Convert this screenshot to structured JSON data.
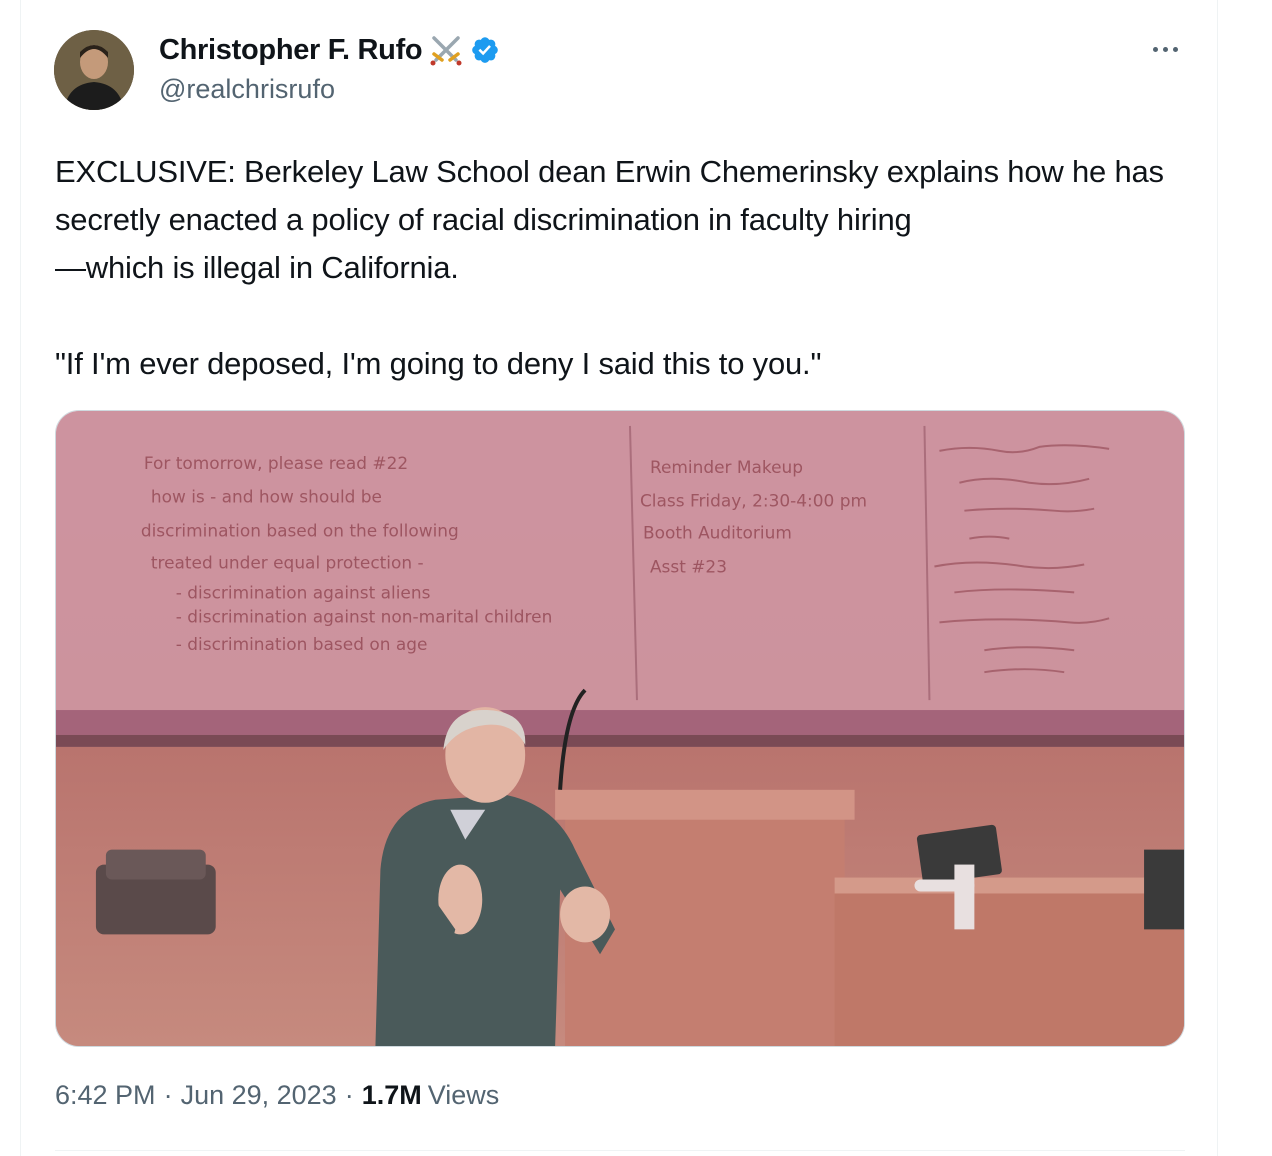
{
  "author": {
    "display_name": "Christopher F. Rufo",
    "handle": "@realchrisrufo",
    "name_emoji": "crossed-swords-icon",
    "verified": true
  },
  "tweet": {
    "paragraph1": "EXCLUSIVE: Berkeley Law School dean Erwin Chemerinsky explains how he has secretly enacted a policy of racial discrimination in faculty hiring\n—which is illegal in California.",
    "paragraph2": "\"If I'm ever deposed, I'm going to deny I said this to you.\""
  },
  "media": {
    "type": "video",
    "board_left": [
      "For tomorrow, please read #22",
      "how is - and how should be",
      "discrimination based on the following",
      "treated under equal protection -",
      "- discrimination against aliens",
      "- discrimination against non-marital children",
      "- discrimination based on age"
    ],
    "board_middle": [
      "Reminder Makeup",
      "Class Friday, 2:30-4:00 pm",
      "Booth Auditorium",
      "Asst #23"
    ]
  },
  "meta": {
    "time": "6:42 PM",
    "date": "Jun 29, 2023",
    "separator": "·",
    "views_count": "1.7M",
    "views_label": "Views"
  },
  "colors": {
    "text_primary": "#0f1419",
    "text_secondary": "#536471",
    "verified_blue": "#1d9bf0",
    "border": "#cfd9de"
  }
}
